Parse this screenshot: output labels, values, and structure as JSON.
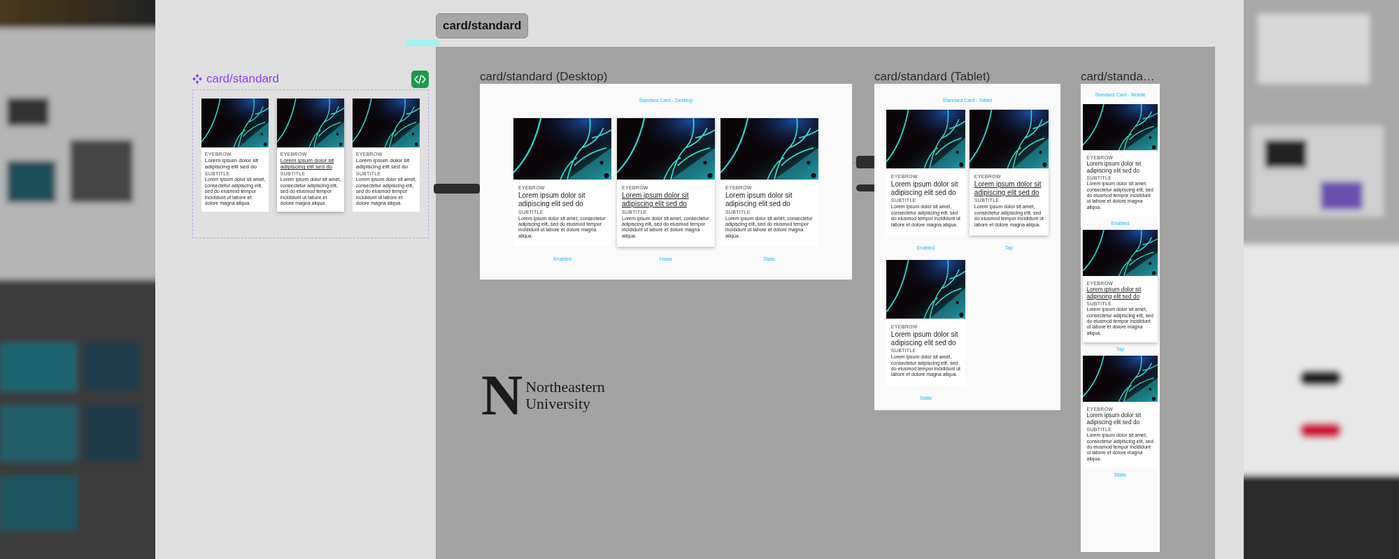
{
  "page_label": "card/standard",
  "component": {
    "title": "card/standard",
    "cards": [
      {
        "eyebrow": "EYEBROW",
        "title": "Lorem ipsum dolor sit adipiscing elit sed do",
        "subtitle": "SUBTITLE",
        "body": "Lorem ipsum dolor sit amet, consectetur adipiscing elit, sed do eiusmod tempor incididunt ut labore et dolore magna aliqua.",
        "hovered": false
      },
      {
        "eyebrow": "EYEBROW",
        "title": "Lorem ipsum dolor sit adipiscing elit sed do",
        "subtitle": "SUBTITLE",
        "body": "Lorem ipsum dolor sit amet, consectetur adipiscing elit, sed do eiusmod tempor incididunt ut labore et dolore magna aliqua.",
        "hovered": true
      },
      {
        "eyebrow": "EYEBROW",
        "title": "Lorem ipsum dolor sit adipiscing elit sed do",
        "subtitle": "SUBTITLE",
        "body": "Lorem ipsum dolor sit amet, consectetur adipiscing elit, sed do eiusmod tempor incididunt ut labore et dolore magna aliqua.",
        "hovered": false
      }
    ]
  },
  "frames": [
    {
      "kind": "desktop",
      "label": "card/standard (Desktop)",
      "heading": "Standard Card - Desktop",
      "cards": [
        {
          "eyebrow": "EYEBROW",
          "title": "Lorem ipsum dolor sit adipiscing elit sed do",
          "subtitle": "SUBTITLE",
          "body": "Lorem ipsum dolor sit amet, consectetur adipiscing elit, sed do eiusmod tempor incididunt ut labore et dolore magna aliqua.",
          "hovered": false,
          "caption": "Enabled"
        },
        {
          "eyebrow": "EYEBROW",
          "title": "Lorem ipsum dolor sit adipiscing elit sed do",
          "subtitle": "SUBTITLE",
          "body": "Lorem ipsum dolor sit amet, consectetur adipiscing elit, sed do eiusmod tempor incididunt ut labore et dolore magna aliqua.",
          "hovered": true,
          "caption": "Hover"
        },
        {
          "eyebrow": "EYEBROW",
          "title": "Lorem ipsum dolor sit adipiscing elit sed do",
          "subtitle": "SUBTITLE",
          "body": "Lorem ipsum dolor sit amet, consectetur adipiscing elit, sed do eiusmod tempor incididunt ut labore et dolore magna aliqua.",
          "hovered": false,
          "caption": "Static"
        }
      ]
    },
    {
      "kind": "tablet",
      "label": "card/standard (Tablet)",
      "heading": "Standard Card - Tablet",
      "cards": [
        {
          "eyebrow": "EYEBROW",
          "title": "Lorem ipsum dolor sit adipiscing elit sed do",
          "subtitle": "SUBTITLE",
          "body": "Lorem ipsum dolor sit amet, consectetur adipiscing elit, sed do eiusmod tempor incididunt ut labore et dolore magna aliqua.",
          "hovered": false,
          "caption": "Enabled"
        },
        {
          "eyebrow": "EYEBROW",
          "title": "Lorem ipsum dolor sit adipiscing elit sed do",
          "subtitle": "SUBTITLE",
          "body": "Lorem ipsum dolor sit amet, consectetur adipiscing elit, sed do eiusmod tempor incididunt ut labore et dolore magna aliqua.",
          "hovered": true,
          "caption": "Tap"
        },
        {
          "eyebrow": "EYEBROW",
          "title": "Lorem ipsum dolor sit adipiscing elit sed do",
          "subtitle": "SUBTITLE",
          "body": "Lorem ipsum dolor sit amet, consectetur adipiscing elit, sed do eiusmod tempor incididunt ut labore et dolore magna aliqua.",
          "hovered": false,
          "caption": "Static"
        }
      ]
    },
    {
      "kind": "mobile",
      "label": "card/standa…",
      "heading": "Standard Card - Mobile",
      "cards": [
        {
          "eyebrow": "EYEBROW",
          "title": "Lorem ipsum dolor sit adipiscing elit sed do",
          "subtitle": "SUBTITLE",
          "body": "Lorem ipsum dolor sit amet, consectetur adipiscing elit, sed do eiusmod tempor incididunt ut labore et dolore magna aliqua.",
          "hovered": false,
          "caption": "Enabled"
        },
        {
          "eyebrow": "EYEBROW",
          "title": "Lorem ipsum dolor sit adipiscing elit sed do",
          "subtitle": "SUBTITLE",
          "body": "Lorem ipsum dolor sit amet, consectetur adipiscing elit, sed do eiusmod tempor incididunt ut labore et dolore magna aliqua.",
          "hovered": true,
          "caption": "Tap"
        },
        {
          "eyebrow": "EYEBROW",
          "title": "Lorem ipsum dolor sit adipiscing elit sed do",
          "subtitle": "SUBTITLE",
          "body": "Lorem ipsum dolor sit amet, consectetur adipiscing elit, sed do eiusmod tempor incididunt ut labore et dolore magna aliqua.",
          "hovered": false,
          "caption": "Static"
        }
      ]
    }
  ],
  "logo": {
    "mark": "N",
    "lines": [
      "Northeastern",
      "University"
    ]
  }
}
